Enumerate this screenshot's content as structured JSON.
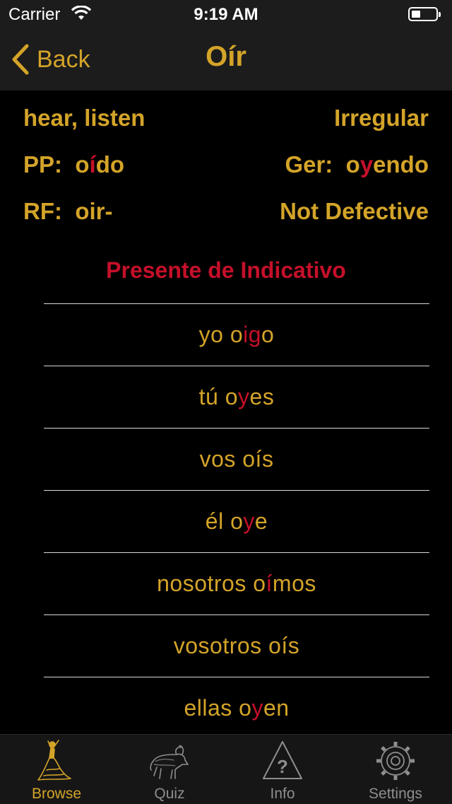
{
  "status_bar": {
    "carrier": "Carrier",
    "time": "9:19 AM"
  },
  "nav": {
    "back_label": "Back",
    "title": "Oír"
  },
  "verb": {
    "meaning": "hear, listen",
    "type": "Irregular",
    "pp_label": "PP:",
    "pp": {
      "pre": "o",
      "hi": "í",
      "post": "do"
    },
    "ger_label": "Ger:",
    "ger": {
      "pre": "o",
      "hi": "y",
      "post": "endo"
    },
    "rf_label": "RF:",
    "rf_value": "oir-",
    "defective": "Not Defective"
  },
  "section_title": "Presente de Indicativo",
  "conjugations": [
    {
      "pre": "yo o",
      "hi": "ig",
      "post": "o"
    },
    {
      "pre": "tú o",
      "hi": "y",
      "post": "es"
    },
    {
      "pre": "vos oís",
      "hi": "",
      "post": ""
    },
    {
      "pre": "él o",
      "hi": "y",
      "post": "e"
    },
    {
      "pre": "nosotros o",
      "hi": "í",
      "post": "mos"
    },
    {
      "pre": "vosotros oís",
      "hi": "",
      "post": ""
    },
    {
      "pre": "ellas o",
      "hi": "y",
      "post": "en"
    }
  ],
  "tabs": [
    {
      "label": "Browse",
      "icon": "flamenco-dancer-icon",
      "active": true
    },
    {
      "label": "Quiz",
      "icon": "bull-icon",
      "active": false
    },
    {
      "label": "Info",
      "icon": "question-triangle-icon",
      "active": false
    },
    {
      "label": "Settings",
      "icon": "gear-icon",
      "active": false
    }
  ],
  "colors": {
    "accent": "#d4a429",
    "highlight": "#c5102a",
    "background": "#000000"
  }
}
